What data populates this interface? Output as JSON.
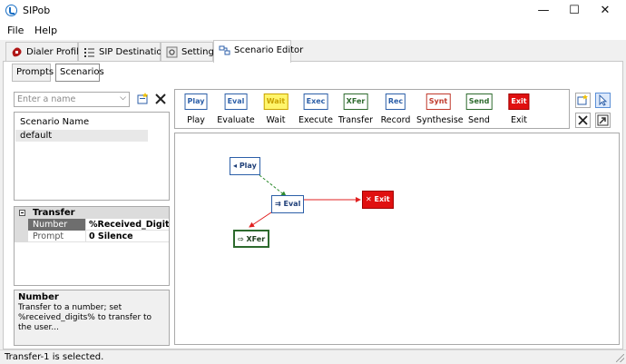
{
  "window": {
    "title": "SIPob",
    "minimize": "—",
    "maximize": "☐",
    "close": "✕"
  },
  "menu": [
    {
      "label": "File"
    },
    {
      "label": "Help"
    }
  ],
  "tabs": [
    {
      "label": "Dialer Profiles",
      "icon": "phone-icon"
    },
    {
      "label": "SIP Destinations",
      "icon": "list-icon"
    },
    {
      "label": "Settings",
      "icon": "gear-icon"
    },
    {
      "label": "Scenario Editor",
      "icon": "flow-icon",
      "active": true
    }
  ],
  "subtabs": [
    {
      "label": "Prompts"
    },
    {
      "label": "Scenarios",
      "active": true
    }
  ],
  "name_combo": {
    "placeholder": "Enter a name"
  },
  "scenario_list": {
    "header": "Scenario Name",
    "rows": [
      "default"
    ]
  },
  "properties": {
    "category": "Transfer",
    "rows": [
      {
        "name": "Number",
        "value": "%Received_Digits%",
        "selected": true
      },
      {
        "name": "Prompt",
        "value": "0 Silence"
      }
    ]
  },
  "description": {
    "title": "Number",
    "text": "Transfer to a number; set %received_digits% to transfer to the user..."
  },
  "toolbar": [
    {
      "icon_text": "Play",
      "label": "Play",
      "color": "#2c5fa8",
      "bg": "#ffffff"
    },
    {
      "icon_text": "Eval",
      "label": "Evaluate",
      "color": "#2c5fa8",
      "bg": "#ffffff"
    },
    {
      "icon_text": "Wait",
      "label": "Wait",
      "color": "#c9a200",
      "bg": "#fff56b"
    },
    {
      "icon_text": "Exec",
      "label": "Execute",
      "color": "#2c5fa8",
      "bg": "#ffffff"
    },
    {
      "icon_text": "XFer",
      "label": "Transfer",
      "color": "#2d6a2d",
      "bg": "#ffffff"
    },
    {
      "icon_text": "Rec",
      "label": "Record",
      "color": "#2c5fa8",
      "bg": "#ffffff"
    },
    {
      "icon_text": "Synt",
      "label": "Synthesise",
      "color": "#c0392b",
      "bg": "#ffffff"
    },
    {
      "icon_text": "Send",
      "label": "Send",
      "color": "#2d6a2d",
      "bg": "#ffffff"
    },
    {
      "icon_text": "Exit",
      "label": "Exit",
      "color": "#a00000",
      "bg": "#e01010"
    }
  ],
  "nodes": [
    {
      "id": "play",
      "label": "Play",
      "color": "#2c5fa8",
      "bg": "#ffffff"
    },
    {
      "id": "eval",
      "label": "Eval",
      "color": "#2c5fa8",
      "bg": "#ffffff"
    },
    {
      "id": "exit",
      "label": "Exit",
      "color": "#a00000",
      "bg": "#e01010"
    },
    {
      "id": "xfer",
      "label": "XFer",
      "color": "#2d6a2d",
      "bg": "#ffffff"
    }
  ],
  "connections": [
    {
      "from": "play",
      "to": "eval",
      "color": "#2e8b2e",
      "style": "dashed"
    },
    {
      "from": "eval",
      "to": "exit",
      "color": "#e02020",
      "style": "solid"
    },
    {
      "from": "eval",
      "to": "xfer",
      "color": "#e02020",
      "style": "solid"
    }
  ],
  "status": {
    "text": "Transfer-1 is selected."
  }
}
